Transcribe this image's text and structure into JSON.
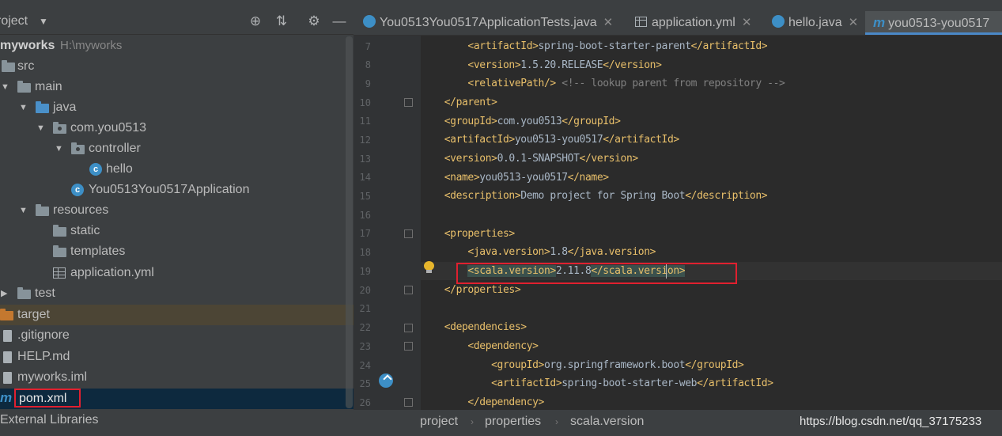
{
  "project_panel": {
    "title": "roject",
    "icons": [
      "target-icon",
      "collapse-icon",
      "gear-icon",
      "minimize-icon"
    ],
    "tree": [
      {
        "label": "myworks",
        "sub": "H:\\myworks",
        "bold": true
      },
      {
        "label": "src"
      },
      {
        "label": "main"
      },
      {
        "label": "java"
      },
      {
        "label": "com.you0513"
      },
      {
        "label": "controller"
      },
      {
        "label": "hello"
      },
      {
        "label": "You0513You0517Application"
      },
      {
        "label": "resources"
      },
      {
        "label": "static"
      },
      {
        "label": "templates"
      },
      {
        "label": "application.yml"
      },
      {
        "label": "test"
      },
      {
        "label": "target"
      },
      {
        "label": ".gitignore"
      },
      {
        "label": "HELP.md"
      },
      {
        "label": "myworks.iml"
      },
      {
        "label": "pom.xml"
      }
    ],
    "external_libraries": "External Libraries"
  },
  "tabs": [
    {
      "label": "You0513You0517ApplicationTests.java",
      "icon": "class-icon"
    },
    {
      "label": "application.yml",
      "icon": "yaml-icon"
    },
    {
      "label": "hello.java",
      "icon": "class-icon"
    },
    {
      "label": "you0513-you0517",
      "icon": "maven-icon",
      "active": true
    }
  ],
  "code": {
    "line_numbers": [
      "7",
      "8",
      "9",
      "10",
      "11",
      "12",
      "13",
      "14",
      "15",
      "16",
      "17",
      "18",
      "19",
      "20",
      "21",
      "22",
      "23",
      "24",
      "25",
      "26"
    ],
    "current_line": "19",
    "lines": {
      "l7": {
        "open": "<artifactId>",
        "text": "spring-boot-starter-parent",
        "close": "</artifactId>"
      },
      "l8": {
        "open": "<version>",
        "text": "1.5.20.RELEASE",
        "close": "</version>"
      },
      "l9": {
        "open": "<relativePath/>",
        "comment": "<!-- lookup parent from repository -->"
      },
      "l10": {
        "close": "</parent>"
      },
      "l11": {
        "open": "<groupId>",
        "text": "com.you0513",
        "close": "</groupId>"
      },
      "l12": {
        "open": "<artifactId>",
        "text": "you0513-you0517",
        "close": "</artifactId>"
      },
      "l13": {
        "open": "<version>",
        "text": "0.0.1-SNAPSHOT",
        "close": "</version>"
      },
      "l14": {
        "open": "<name>",
        "text": "you0513-you0517",
        "close": "</name>"
      },
      "l15": {
        "open": "<description>",
        "text": "Demo project for Spring Boot",
        "close": "</description>"
      },
      "l17": {
        "open": "<properties>"
      },
      "l18": {
        "open": "<java.version>",
        "text": "1.8",
        "close": "</java.version>"
      },
      "l19": {
        "open": "<scala.version>",
        "text": "2.11.8",
        "close": "</scala.version>"
      },
      "l20": {
        "close": "</properties>"
      },
      "l22": {
        "open": "<dependencies>"
      },
      "l23": {
        "open": "<dependency>"
      },
      "l24": {
        "open": "<groupId>",
        "text": "org.springframework.boot",
        "close": "</groupId>"
      },
      "l25": {
        "open": "<artifactId>",
        "text": "spring-boot-starter-web",
        "close": "</artifactId>"
      },
      "l26": {
        "close": "</dependency>"
      }
    }
  },
  "breadcrumb": [
    "project",
    "properties",
    "scala.version"
  ],
  "watermark": "https://blog.csdn.net/qq_37175233"
}
